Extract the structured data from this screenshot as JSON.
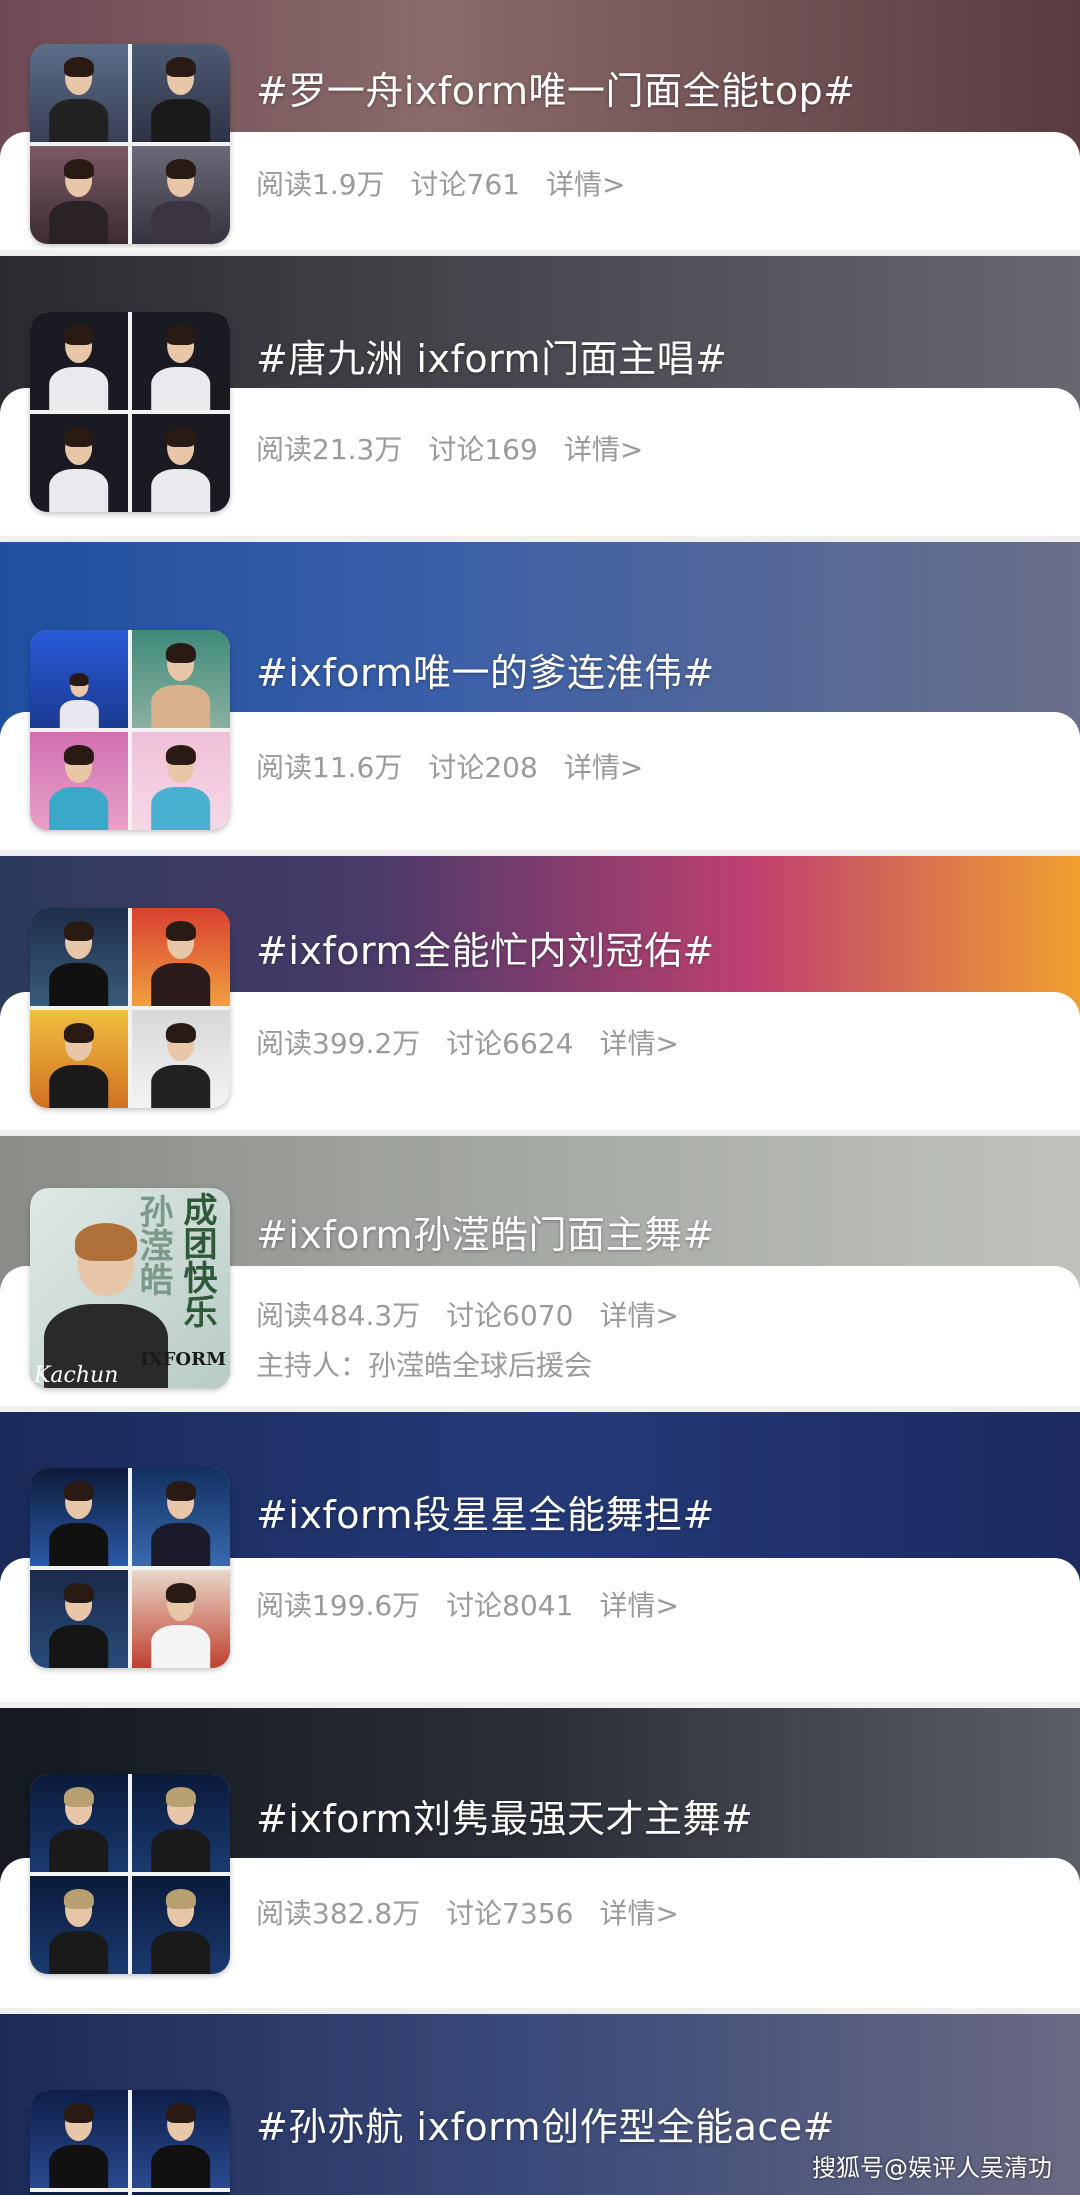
{
  "topics": [
    {
      "title": "#罗一舟ixform唯一门面全能top#",
      "read": "阅读1.9万",
      "discuss": "讨论761",
      "detail": "详情>"
    },
    {
      "title": "#唐九洲 ixform门面主唱#",
      "read": "阅读21.3万",
      "discuss": "讨论169",
      "detail": "详情>"
    },
    {
      "title": "#ixform唯一的爹连淮伟#",
      "read": "阅读11.6万",
      "discuss": "讨论208",
      "detail": "详情>"
    },
    {
      "title": "#ixform全能忙内刘冠佑#",
      "read": "阅读399.2万",
      "discuss": "讨论6624",
      "detail": "详情>"
    },
    {
      "title": "#ixform孙滢皓门面主舞#",
      "read": "阅读484.3万",
      "discuss": "讨论6070",
      "detail": "详情>",
      "host": "主持人：孙滢皓全球后援会",
      "cover_text_1": "孙滢皓",
      "cover_text_2": "成团快乐",
      "cover_brand": "IXFORM",
      "cover_sign": "Kachun"
    },
    {
      "title": "#ixform段星星全能舞担#",
      "read": "阅读199.6万",
      "discuss": "讨论8041",
      "detail": "详情>"
    },
    {
      "title": "#ixform刘隽最强天才主舞#",
      "read": "阅读382.8万",
      "discuss": "讨论7356",
      "detail": "详情>"
    },
    {
      "title": "#孙亦航 ixform创作型全能ace#"
    }
  ],
  "watermark": "搜狐号@娱评人吴清功",
  "colors": {
    "stats_text": "#9a9a9a",
    "title_text": "#ffffff",
    "panel": "#ffffff"
  }
}
